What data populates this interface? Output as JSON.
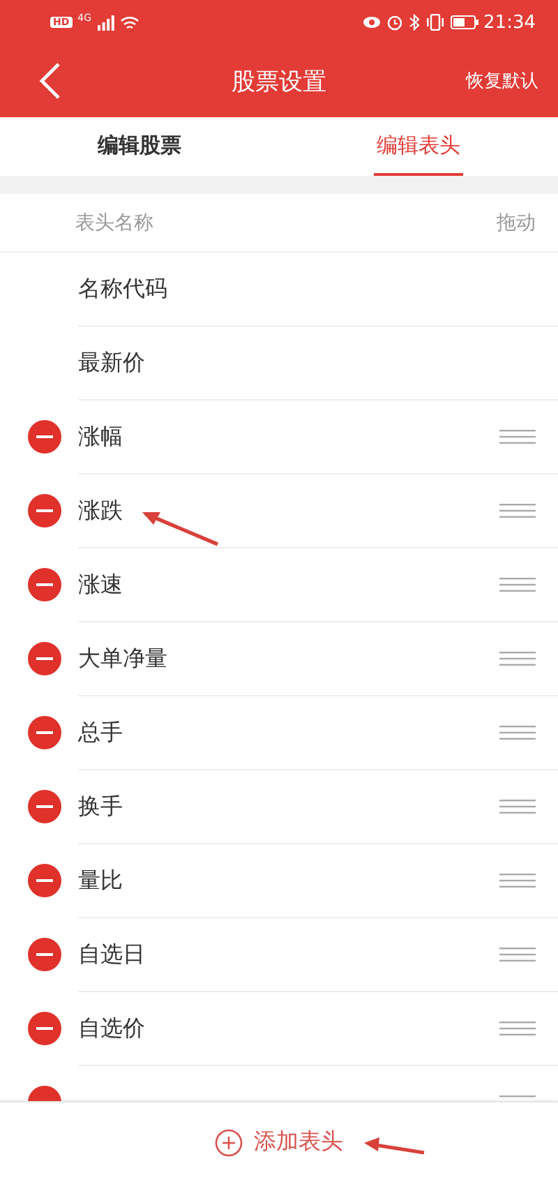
{
  "status_bar": {
    "hd": "HD",
    "network": "4G",
    "time": "21:34"
  },
  "header": {
    "title": "股票设置",
    "action": "恢复默认"
  },
  "tabs": [
    {
      "label": "编辑股票",
      "selected": false
    },
    {
      "label": "编辑表头",
      "selected": true
    }
  ],
  "list_header": {
    "name": "表头名称",
    "drag": "拖动"
  },
  "rows": [
    {
      "label": "名称代码",
      "kind": "fixed"
    },
    {
      "label": "最新价",
      "kind": "fixed"
    },
    {
      "label": "涨幅",
      "kind": "removable"
    },
    {
      "label": "涨跌",
      "kind": "removable"
    },
    {
      "label": "涨速",
      "kind": "removable"
    },
    {
      "label": "大单净量",
      "kind": "removable"
    },
    {
      "label": "总手",
      "kind": "removable"
    },
    {
      "label": "换手",
      "kind": "removable"
    },
    {
      "label": "量比",
      "kind": "removable"
    },
    {
      "label": "自选日",
      "kind": "removable"
    },
    {
      "label": "自选价",
      "kind": "removable"
    },
    {
      "kind": "removable"
    }
  ],
  "add_button": {
    "label": "添加表头"
  }
}
